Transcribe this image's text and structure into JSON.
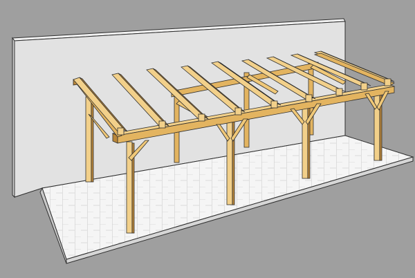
{
  "scene": {
    "subject": "timber-pergola-3d-model",
    "colors": {
      "background": "#9f9f9f",
      "wall_face": "#e2e2e2",
      "wall_side": "#cdcdcd",
      "wall_top": "#f2f2f2",
      "deck_top": "#f5f5f5",
      "deck_front": "#d6d6d6",
      "deck_side": "#c8c8c8",
      "deck_line": "#c6c6c6",
      "wood_light": "#f2d08a",
      "wood_mid": "#e3b460",
      "wood_dark": "#b9863a",
      "edge": "#2e2e2e"
    }
  }
}
